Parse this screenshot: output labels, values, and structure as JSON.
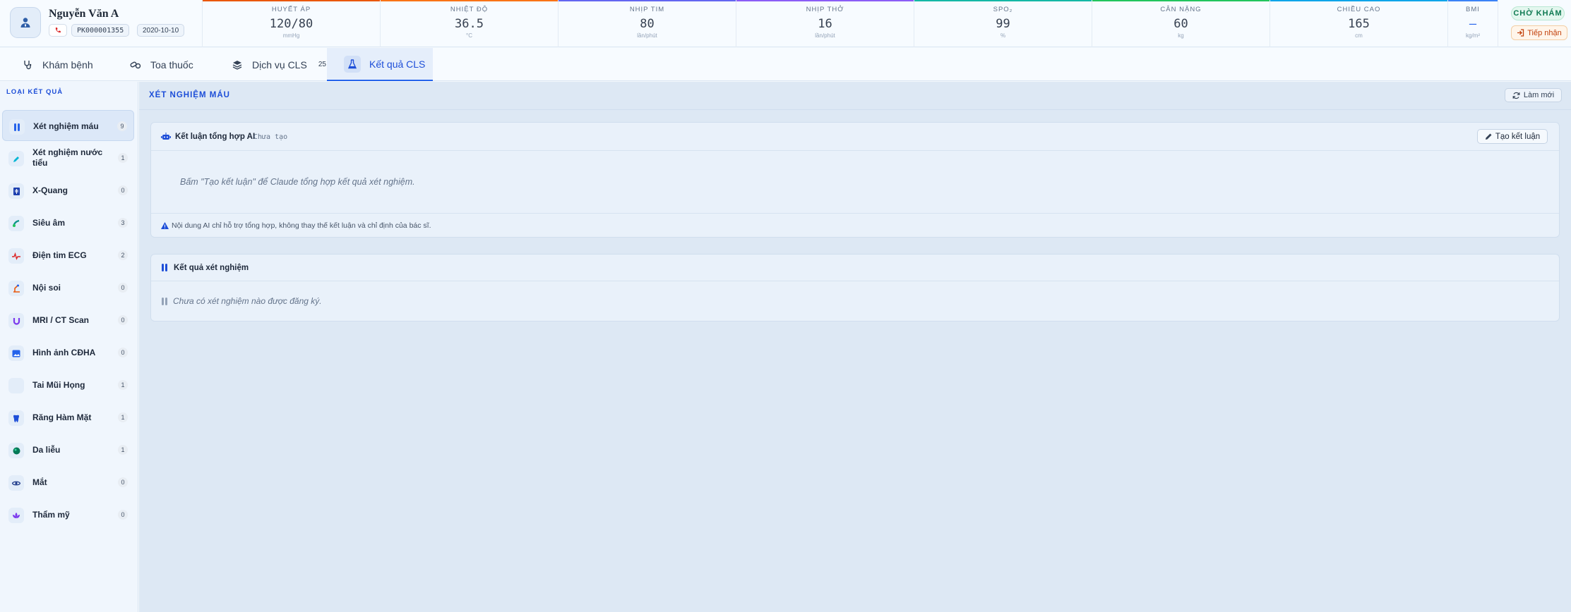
{
  "patient": {
    "name": "Nguyễn Văn A",
    "code": "PK000001355",
    "dob": "2020-10-10"
  },
  "vitals": [
    {
      "label": "HUYẾT ÁP",
      "value": "120/80",
      "unit": "mmHg",
      "color": "#ea580c"
    },
    {
      "label": "NHIỆT ĐỘ",
      "value": "36.5",
      "unit": "°C",
      "color": "#f97316"
    },
    {
      "label": "NHỊP TIM",
      "value": "80",
      "unit": "lần/phút",
      "color": "#6366f1"
    },
    {
      "label": "NHỊP THỞ",
      "value": "16",
      "unit": "lần/phút",
      "color": "#8b5cf6"
    },
    {
      "label": "SPO₂",
      "value": "99",
      "unit": "%",
      "color": "#14b8a6"
    },
    {
      "label": "CÂN NẶNG",
      "value": "60",
      "unit": "kg",
      "color": "#22c55e"
    },
    {
      "label": "CHIỀU CAO",
      "value": "165",
      "unit": "cm",
      "color": "#0ea5e9"
    },
    {
      "label": "BMI",
      "value": "—",
      "unit": "kg/m²",
      "color": "#3b82f6"
    }
  ],
  "status": {
    "badge": "CHỜ KHÁM",
    "action": "Tiếp nhận"
  },
  "tabs": [
    {
      "label": "Khám bệnh",
      "icon": "stethoscope-icon"
    },
    {
      "label": "Toa thuốc",
      "icon": "pills-icon"
    },
    {
      "label": "Dịch vụ CLS",
      "count": "25",
      "icon": "layers-icon"
    },
    {
      "label": "Kết quả CLS",
      "icon": "flask-icon",
      "active": true
    }
  ],
  "sidebar": {
    "title": "LOẠI KẾT QUẢ",
    "items": [
      {
        "label": "Xét nghiệm máu",
        "count": "9",
        "icon": "test-tube-icon",
        "color": "#2563eb",
        "active": true
      },
      {
        "label": "Xét nghiệm nước tiểu",
        "count": "1",
        "icon": "dropper-icon",
        "color": "#06b6d4"
      },
      {
        "label": "X-Quang",
        "count": "0",
        "icon": "xray-icon",
        "color": "#1e40af"
      },
      {
        "label": "Siêu âm",
        "count": "3",
        "icon": "ultrasound-icon",
        "color": "#0d9488"
      },
      {
        "label": "Điện tim ECG",
        "count": "2",
        "icon": "heartbeat-icon",
        "color": "#dc2626"
      },
      {
        "label": "Nội soi",
        "count": "0",
        "icon": "endoscope-icon",
        "color": "#ea580c"
      },
      {
        "label": "MRI / CT Scan",
        "count": "0",
        "icon": "magnet-icon",
        "color": "#7c3aed"
      },
      {
        "label": "Hình ảnh CĐHA",
        "count": "0",
        "icon": "image-icon",
        "color": "#2563eb"
      },
      {
        "label": "Tai Mũi Họng",
        "count": "1",
        "icon": "ent-icon",
        "color": "#64748b"
      },
      {
        "label": "Răng Hàm Mặt",
        "count": "1",
        "icon": "tooth-icon",
        "color": "#1d4ed8"
      },
      {
        "label": "Da liễu",
        "count": "1",
        "icon": "skin-icon",
        "color": "#047857"
      },
      {
        "label": "Mắt",
        "count": "0",
        "icon": "eye-icon",
        "color": "#1e3a8a"
      },
      {
        "label": "Thẩm mỹ",
        "count": "0",
        "icon": "lotus-icon",
        "color": "#7c3aed"
      }
    ]
  },
  "main": {
    "section_title": "XÉT NGHIỆM MÁU",
    "refresh_label": "Làm mới",
    "ai_card": {
      "title": "Kết luận tổng hợp AI",
      "status": "Chưa tạo",
      "button": "Tạo kết luận",
      "hint": "Bấm \"Tạo kết luận\" để Claude tổng hợp kết quả xét nghiệm.",
      "disclaimer": "Nội dung AI chỉ hỗ trợ tổng hợp, không thay thế kết luận và chỉ định của bác sĩ."
    },
    "results_card": {
      "title": "Kết quả xét nghiệm",
      "empty": "Chưa có xét nghiệm nào được đăng ký."
    }
  }
}
